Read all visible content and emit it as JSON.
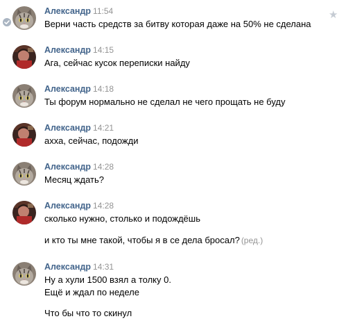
{
  "messages": [
    {
      "avatar": "cat-avatar",
      "author": "Александр",
      "time": "11:54",
      "lines": [
        "Верни часть средств за битву которая даже на 50% не сделана"
      ]
    },
    {
      "avatar": "photo-avatar",
      "author": "Александр",
      "time": "14:15",
      "lines": [
        "Ага, сейчас кусок переписки найду"
      ]
    },
    {
      "avatar": "cat-avatar",
      "author": "Александр",
      "time": "14:18",
      "lines": [
        "Ты форум нормально не сделал не чего прощать не буду"
      ]
    },
    {
      "avatar": "photo-avatar",
      "author": "Александр",
      "time": "14:21",
      "lines": [
        "ахха, сейчас, подожди"
      ]
    },
    {
      "avatar": "cat-avatar",
      "author": "Александр",
      "time": "14:28",
      "lines": [
        "Месяц ждать?"
      ]
    },
    {
      "avatar": "photo-avatar",
      "author": "Александр",
      "time": "14:28",
      "lines": [
        "сколько нужно, столько и подождёшь",
        "и кто ты мне такой, чтобы я в се дела бросал?"
      ],
      "edited": "(ред.)"
    },
    {
      "avatar": "cat-avatar",
      "author": "Александр",
      "time": "14:31",
      "lines": [
        "Ну а хули 1500 взял а толку 0.",
        "Ещё и ждал по неделе",
        "Что бы что то скинул"
      ]
    }
  ],
  "icons": {
    "read_check": "checkmark-icon",
    "favorite": "star-icon"
  },
  "colors": {
    "author": "#42648b",
    "timestamp": "#939393",
    "star": "#c5cbd3"
  }
}
